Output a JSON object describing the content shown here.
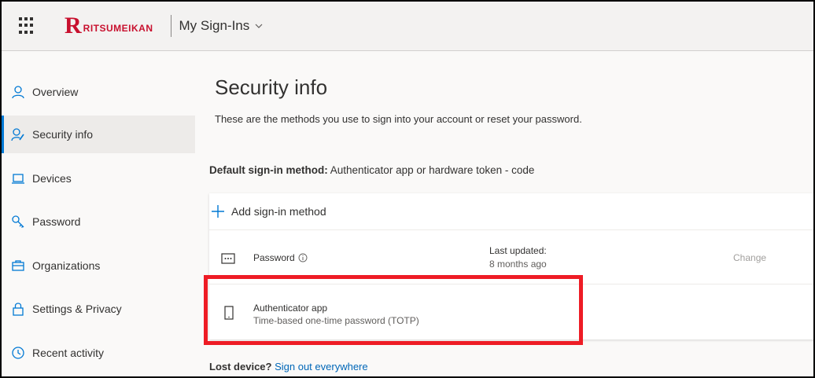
{
  "header": {
    "logo_letter": "R",
    "logo_text": "RITSUMEIKAN",
    "app_title": "My Sign-Ins"
  },
  "sidebar": {
    "items": [
      {
        "label": "Overview",
        "icon": "person-icon"
      },
      {
        "label": "Security info",
        "icon": "security-info-icon"
      },
      {
        "label": "Devices",
        "icon": "laptop-icon"
      },
      {
        "label": "Password",
        "icon": "key-icon"
      },
      {
        "label": "Organizations",
        "icon": "briefcase-icon"
      },
      {
        "label": "Settings & Privacy",
        "icon": "lock-icon"
      },
      {
        "label": "Recent activity",
        "icon": "history-icon"
      }
    ],
    "active_index": 1
  },
  "main": {
    "title": "Security info",
    "subtitle": "These are the methods you use to sign into your account or reset your password.",
    "default_method_label": "Default sign-in method:",
    "default_method_value": "Authenticator app or hardware token - code",
    "add_method_label": "Add sign-in method",
    "methods": [
      {
        "name": "Password",
        "last_updated_label": "Last updated:",
        "last_updated_value": "8 months ago",
        "action": "Change"
      },
      {
        "name": "Authenticator app",
        "description": "Time-based one-time password (TOTP)"
      }
    ],
    "lost_device_label": "Lost device?",
    "lost_device_link": "Sign out everywhere"
  },
  "colors": {
    "accent": "#0078d4",
    "brand": "#c8102e",
    "highlight": "#ee1c25",
    "link": "#0067b8"
  }
}
